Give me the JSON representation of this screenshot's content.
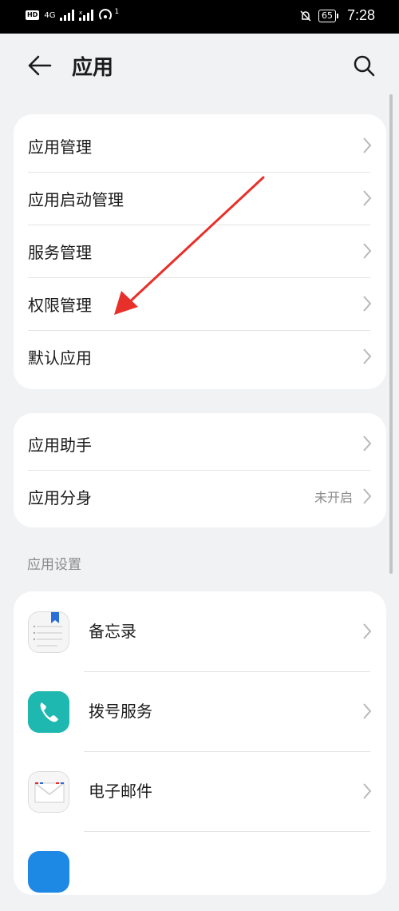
{
  "status_bar": {
    "hd": "HD",
    "network": "4G",
    "hotspot_count": "1",
    "battery": "65",
    "time": "7:28"
  },
  "header": {
    "title": "应用",
    "back_icon": "arrow-left-icon",
    "search_icon": "search-icon"
  },
  "group1": {
    "items": [
      {
        "label": "应用管理"
      },
      {
        "label": "应用启动管理"
      },
      {
        "label": "服务管理"
      },
      {
        "label": "权限管理"
      },
      {
        "label": "默认应用"
      }
    ]
  },
  "group2": {
    "items": [
      {
        "label": "应用助手",
        "value": ""
      },
      {
        "label": "应用分身",
        "value": "未开启"
      }
    ]
  },
  "app_settings": {
    "section_title": "应用设置",
    "apps": [
      {
        "label": "备忘录",
        "icon": "notepad-icon"
      },
      {
        "label": "拨号服务",
        "icon": "phone-icon"
      },
      {
        "label": "电子邮件",
        "icon": "mail-icon"
      }
    ]
  },
  "colors": {
    "background": "#f1f2f4",
    "card": "#ffffff",
    "secondary_text": "#8a8a8a",
    "annotation": "#e8302a",
    "dialer": "#1fb8b0"
  }
}
